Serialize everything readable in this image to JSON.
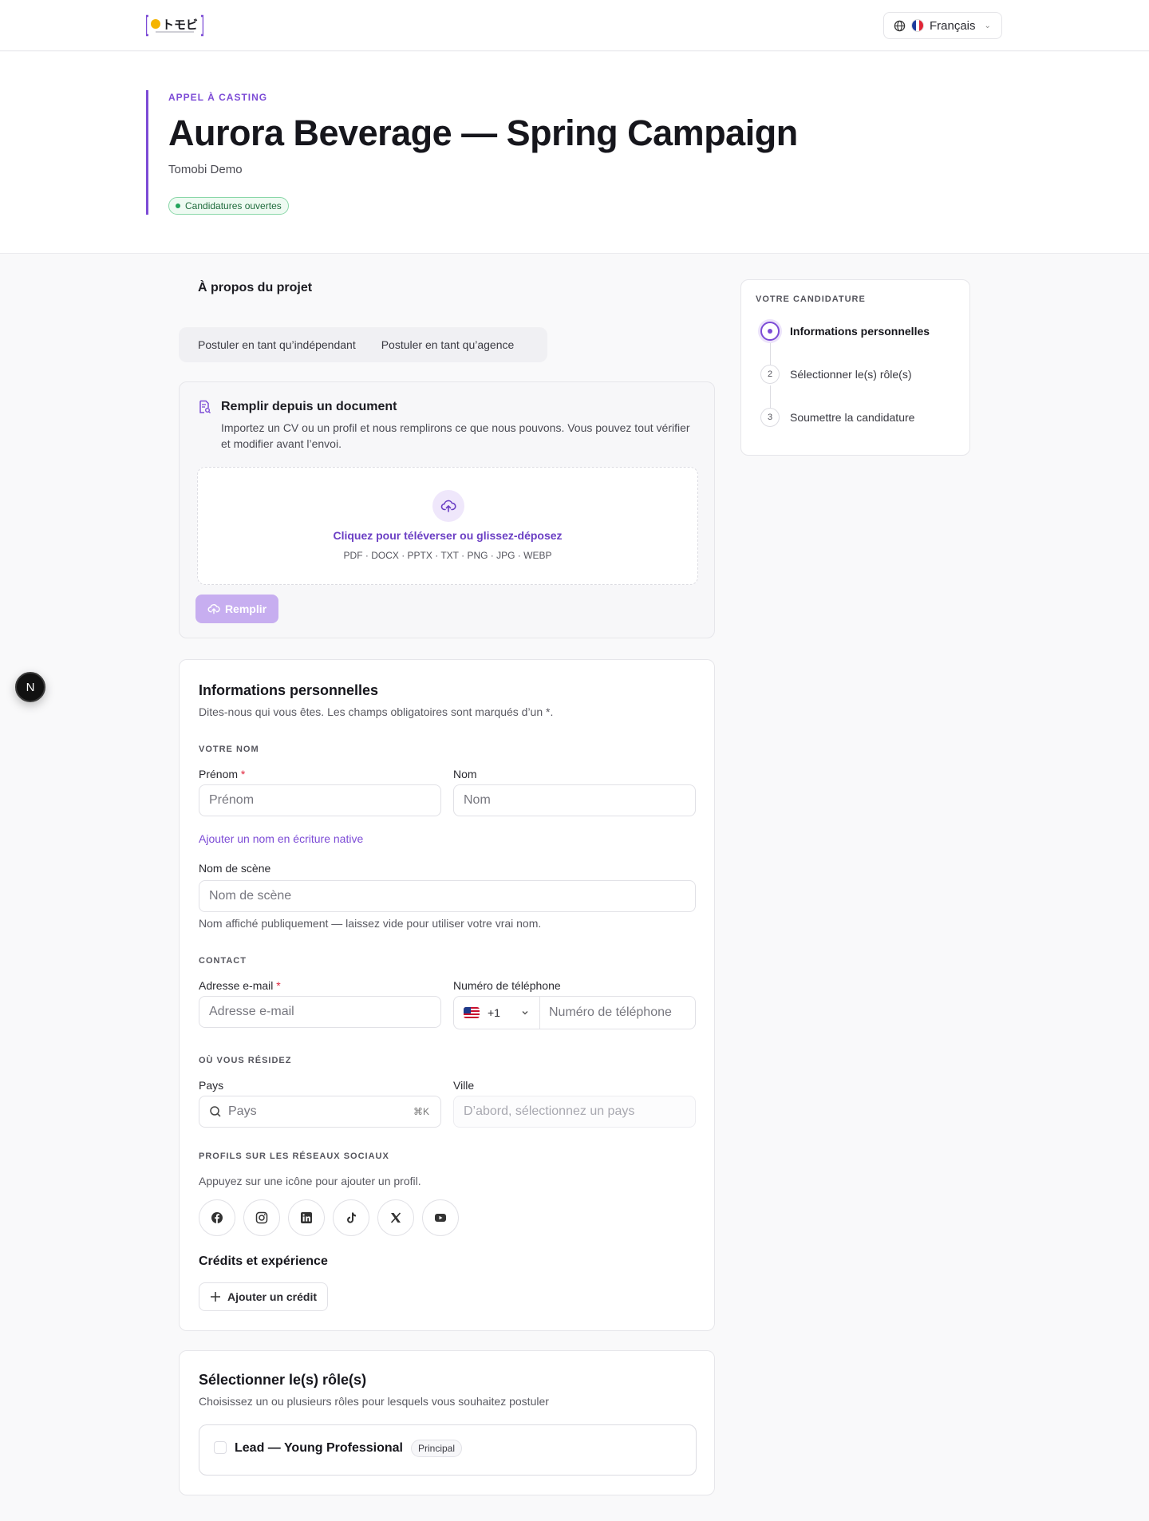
{
  "header": {
    "logo_alt": "Tomobi logo",
    "language": "Français"
  },
  "hero": {
    "eyebrow": "APPEL À CASTING",
    "title": "Aurora Beverage — Spring Campaign",
    "organizer": "Tomobi Demo",
    "status": "Candidatures ouvertes"
  },
  "project": {
    "about_label": "À propos du projet",
    "tabs": [
      "Postuler en tant qu’indépendant",
      "Postuler en tant qu’agence"
    ]
  },
  "document": {
    "title": "Remplir depuis un document",
    "description": "Importez un CV ou un profil et nous remplirons ce que nous pouvons. Vous pouvez tout vérifier et modifier avant l’envoi.",
    "upload_text": "Cliquez pour téléverser ou glissez-déposez",
    "formats": "PDF · DOCX · PPTX · TXT · PNG · JPG · WEBP",
    "fill_button": "Remplir"
  },
  "personal": {
    "title": "Informations personnelles",
    "description": "Dites-nous qui vous êtes. Les champs obligatoires sont marqués d’un *.",
    "name_group": "VOTRE NOM",
    "first_name_label": "Prénom",
    "first_name_placeholder": "Prénom",
    "last_name_label": "Nom",
    "last_name_placeholder": "Nom",
    "native_name_link": "Ajouter un nom en écriture native",
    "stage_name_label": "Nom de scène",
    "stage_name_placeholder": "Nom de scène",
    "stage_name_hint": "Nom affiché publiquement — laissez vide pour utiliser votre vrai nom.",
    "contact_group": "CONTACT",
    "email_label": "Adresse e-mail",
    "email_placeholder": "Adresse e-mail",
    "phone_label": "Numéro de téléphone",
    "phone_code": "+1",
    "phone_placeholder": "Numéro de téléphone",
    "location_group": "OÙ VOUS RÉSIDEZ",
    "country_label": "Pays",
    "country_placeholder": "Pays",
    "country_shortcut": "⌘K",
    "city_label": "Ville",
    "city_placeholder": "D’abord, sélectionnez un pays",
    "social_group": "PROFILS SUR LES RÉSEAUX SOCIAUX",
    "social_hint": "Appuyez sur une icône pour ajouter un profil.",
    "social_icons": [
      "facebook-icon",
      "instagram-icon",
      "linkedin-icon",
      "tiktok-icon",
      "x-icon",
      "youtube-icon"
    ],
    "credits_title": "Crédits et expérience",
    "add_credit": "Ajouter un crédit",
    "required_mark": "*"
  },
  "roles": {
    "title": "Sélectionner le(s) rôle(s)",
    "description": "Choisissez un ou plusieurs rôles pour lesquels vous souhaitez postuler",
    "items": [
      {
        "name": "Lead — Young Professional",
        "badge": "Principal"
      }
    ]
  },
  "sidebar": {
    "title": "VOTRE CANDIDATURE",
    "steps": [
      {
        "number": "1",
        "label": "Informations personnelles",
        "active": true
      },
      {
        "number": "2",
        "label": "Sélectionner le(s) rôle(s)",
        "active": false
      },
      {
        "number": "3",
        "label": "Soumettre la candidature",
        "active": false
      }
    ]
  },
  "floating": {
    "badge": "N"
  },
  "colors": {
    "accent": "#7c4bd6",
    "status_green": "#22a35a",
    "required": "#e0243c"
  }
}
